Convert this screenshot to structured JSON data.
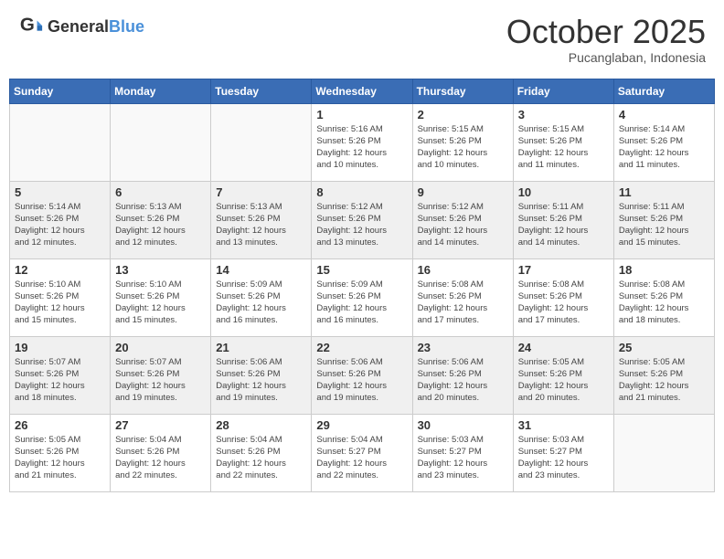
{
  "header": {
    "logo_general": "General",
    "logo_blue": "Blue",
    "month": "October 2025",
    "location": "Pucanglaban, Indonesia"
  },
  "days_of_week": [
    "Sunday",
    "Monday",
    "Tuesday",
    "Wednesday",
    "Thursday",
    "Friday",
    "Saturday"
  ],
  "weeks": [
    {
      "shaded": false,
      "days": [
        {
          "number": "",
          "info": ""
        },
        {
          "number": "",
          "info": ""
        },
        {
          "number": "",
          "info": ""
        },
        {
          "number": "1",
          "info": "Sunrise: 5:16 AM\nSunset: 5:26 PM\nDaylight: 12 hours\nand 10 minutes."
        },
        {
          "number": "2",
          "info": "Sunrise: 5:15 AM\nSunset: 5:26 PM\nDaylight: 12 hours\nand 10 minutes."
        },
        {
          "number": "3",
          "info": "Sunrise: 5:15 AM\nSunset: 5:26 PM\nDaylight: 12 hours\nand 11 minutes."
        },
        {
          "number": "4",
          "info": "Sunrise: 5:14 AM\nSunset: 5:26 PM\nDaylight: 12 hours\nand 11 minutes."
        }
      ]
    },
    {
      "shaded": true,
      "days": [
        {
          "number": "5",
          "info": "Sunrise: 5:14 AM\nSunset: 5:26 PM\nDaylight: 12 hours\nand 12 minutes."
        },
        {
          "number": "6",
          "info": "Sunrise: 5:13 AM\nSunset: 5:26 PM\nDaylight: 12 hours\nand 12 minutes."
        },
        {
          "number": "7",
          "info": "Sunrise: 5:13 AM\nSunset: 5:26 PM\nDaylight: 12 hours\nand 13 minutes."
        },
        {
          "number": "8",
          "info": "Sunrise: 5:12 AM\nSunset: 5:26 PM\nDaylight: 12 hours\nand 13 minutes."
        },
        {
          "number": "9",
          "info": "Sunrise: 5:12 AM\nSunset: 5:26 PM\nDaylight: 12 hours\nand 14 minutes."
        },
        {
          "number": "10",
          "info": "Sunrise: 5:11 AM\nSunset: 5:26 PM\nDaylight: 12 hours\nand 14 minutes."
        },
        {
          "number": "11",
          "info": "Sunrise: 5:11 AM\nSunset: 5:26 PM\nDaylight: 12 hours\nand 15 minutes."
        }
      ]
    },
    {
      "shaded": false,
      "days": [
        {
          "number": "12",
          "info": "Sunrise: 5:10 AM\nSunset: 5:26 PM\nDaylight: 12 hours\nand 15 minutes."
        },
        {
          "number": "13",
          "info": "Sunrise: 5:10 AM\nSunset: 5:26 PM\nDaylight: 12 hours\nand 15 minutes."
        },
        {
          "number": "14",
          "info": "Sunrise: 5:09 AM\nSunset: 5:26 PM\nDaylight: 12 hours\nand 16 minutes."
        },
        {
          "number": "15",
          "info": "Sunrise: 5:09 AM\nSunset: 5:26 PM\nDaylight: 12 hours\nand 16 minutes."
        },
        {
          "number": "16",
          "info": "Sunrise: 5:08 AM\nSunset: 5:26 PM\nDaylight: 12 hours\nand 17 minutes."
        },
        {
          "number": "17",
          "info": "Sunrise: 5:08 AM\nSunset: 5:26 PM\nDaylight: 12 hours\nand 17 minutes."
        },
        {
          "number": "18",
          "info": "Sunrise: 5:08 AM\nSunset: 5:26 PM\nDaylight: 12 hours\nand 18 minutes."
        }
      ]
    },
    {
      "shaded": true,
      "days": [
        {
          "number": "19",
          "info": "Sunrise: 5:07 AM\nSunset: 5:26 PM\nDaylight: 12 hours\nand 18 minutes."
        },
        {
          "number": "20",
          "info": "Sunrise: 5:07 AM\nSunset: 5:26 PM\nDaylight: 12 hours\nand 19 minutes."
        },
        {
          "number": "21",
          "info": "Sunrise: 5:06 AM\nSunset: 5:26 PM\nDaylight: 12 hours\nand 19 minutes."
        },
        {
          "number": "22",
          "info": "Sunrise: 5:06 AM\nSunset: 5:26 PM\nDaylight: 12 hours\nand 19 minutes."
        },
        {
          "number": "23",
          "info": "Sunrise: 5:06 AM\nSunset: 5:26 PM\nDaylight: 12 hours\nand 20 minutes."
        },
        {
          "number": "24",
          "info": "Sunrise: 5:05 AM\nSunset: 5:26 PM\nDaylight: 12 hours\nand 20 minutes."
        },
        {
          "number": "25",
          "info": "Sunrise: 5:05 AM\nSunset: 5:26 PM\nDaylight: 12 hours\nand 21 minutes."
        }
      ]
    },
    {
      "shaded": false,
      "days": [
        {
          "number": "26",
          "info": "Sunrise: 5:05 AM\nSunset: 5:26 PM\nDaylight: 12 hours\nand 21 minutes."
        },
        {
          "number": "27",
          "info": "Sunrise: 5:04 AM\nSunset: 5:26 PM\nDaylight: 12 hours\nand 22 minutes."
        },
        {
          "number": "28",
          "info": "Sunrise: 5:04 AM\nSunset: 5:26 PM\nDaylight: 12 hours\nand 22 minutes."
        },
        {
          "number": "29",
          "info": "Sunrise: 5:04 AM\nSunset: 5:27 PM\nDaylight: 12 hours\nand 22 minutes."
        },
        {
          "number": "30",
          "info": "Sunrise: 5:03 AM\nSunset: 5:27 PM\nDaylight: 12 hours\nand 23 minutes."
        },
        {
          "number": "31",
          "info": "Sunrise: 5:03 AM\nSunset: 5:27 PM\nDaylight: 12 hours\nand 23 minutes."
        },
        {
          "number": "",
          "info": ""
        }
      ]
    }
  ]
}
